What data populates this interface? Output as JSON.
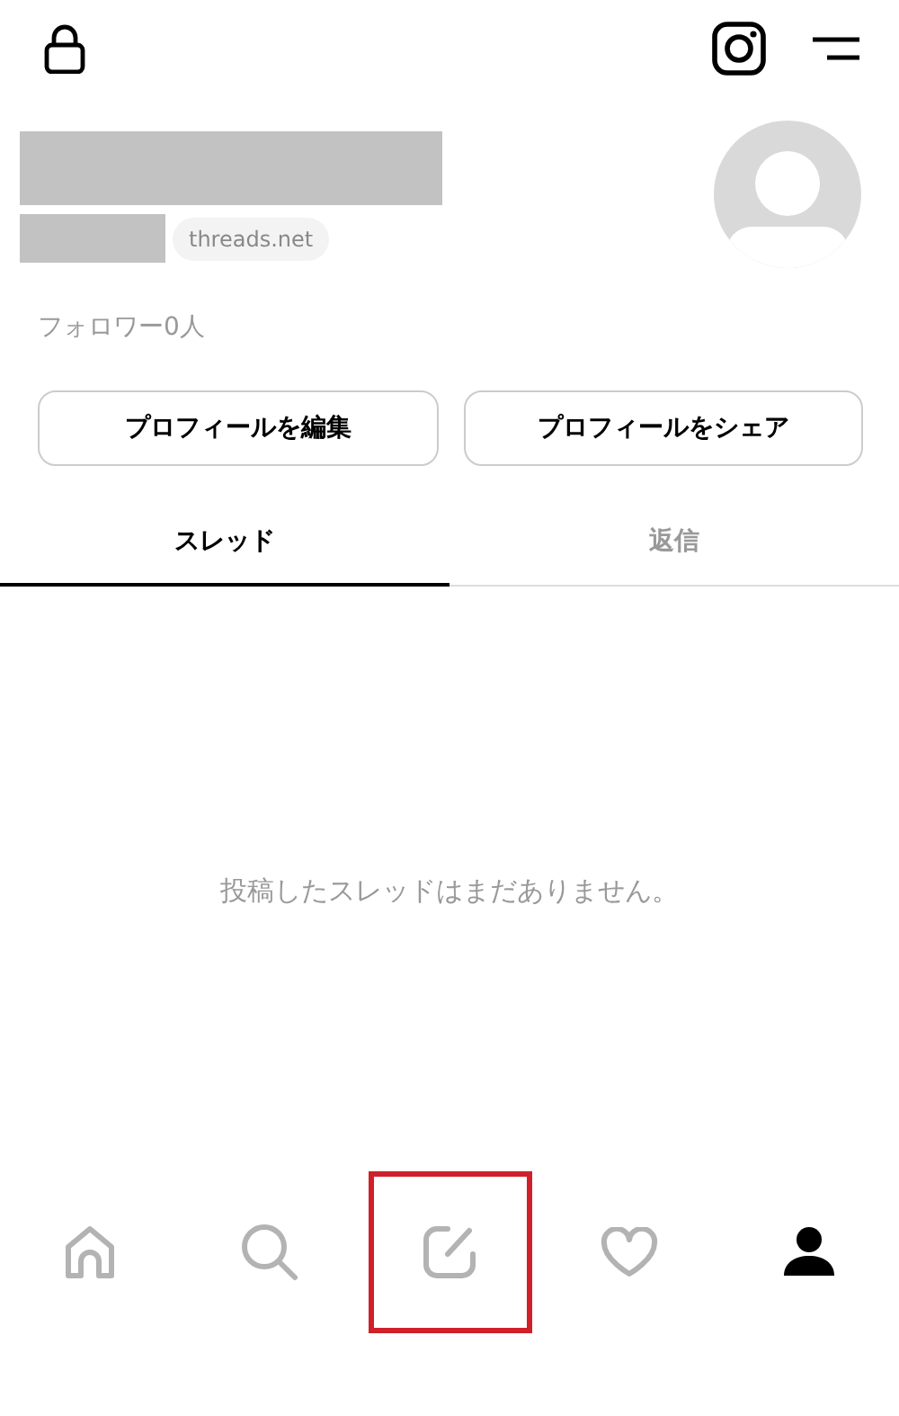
{
  "profile": {
    "domain": "threads.net",
    "followers": "フォロワー0人"
  },
  "buttons": [
    "プロフィールを編集",
    "プロフィールをシェア"
  ],
  "tabs": [
    {
      "label": "スレッド",
      "selected": true
    },
    {
      "label": "返信",
      "selected": false
    }
  ],
  "empty_message": "投稿したスレッドはまだありません。",
  "nav": [
    {
      "kind": "home",
      "selected": false,
      "highlighted": false
    },
    {
      "kind": "search",
      "selected": false,
      "highlighted": false
    },
    {
      "kind": "compose",
      "selected": false,
      "highlighted": true
    },
    {
      "kind": "heart",
      "selected": false,
      "highlighted": false
    },
    {
      "kind": "profile",
      "selected": true,
      "highlighted": false
    }
  ]
}
